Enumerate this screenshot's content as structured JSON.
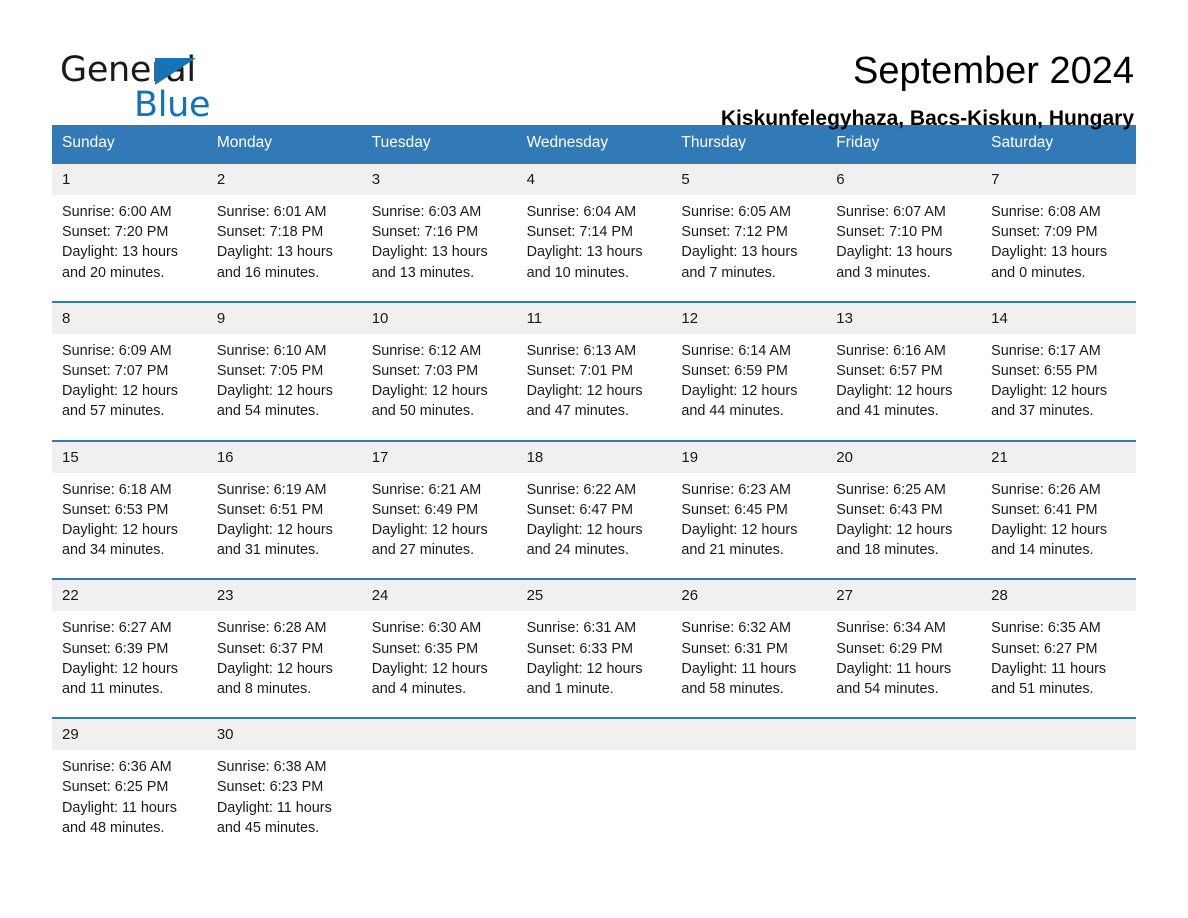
{
  "brand": {
    "word_general": "General",
    "word_blue": "Blue",
    "triangle_color": "#1574b8",
    "blue_text_color": "#0f73bd"
  },
  "header": {
    "month_title": "September 2024",
    "location": "Kiskunfelegyhaza, Bacs-Kiskun, Hungary"
  },
  "theme": {
    "header_blue": "#3279b7",
    "daynum_row_bg": "#f0f0f0",
    "text": "#1a1a1a"
  },
  "calendar": {
    "weekdays": [
      "Sunday",
      "Monday",
      "Tuesday",
      "Wednesday",
      "Thursday",
      "Friday",
      "Saturday"
    ],
    "weeks": [
      {
        "days": [
          {
            "num": "1",
            "sunrise": "Sunrise: 6:00 AM",
            "sunset": "Sunset: 7:20 PM",
            "daylight_1": "Daylight: 13 hours",
            "daylight_2": "and 20 minutes."
          },
          {
            "num": "2",
            "sunrise": "Sunrise: 6:01 AM",
            "sunset": "Sunset: 7:18 PM",
            "daylight_1": "Daylight: 13 hours",
            "daylight_2": "and 16 minutes."
          },
          {
            "num": "3",
            "sunrise": "Sunrise: 6:03 AM",
            "sunset": "Sunset: 7:16 PM",
            "daylight_1": "Daylight: 13 hours",
            "daylight_2": "and 13 minutes."
          },
          {
            "num": "4",
            "sunrise": "Sunrise: 6:04 AM",
            "sunset": "Sunset: 7:14 PM",
            "daylight_1": "Daylight: 13 hours",
            "daylight_2": "and 10 minutes."
          },
          {
            "num": "5",
            "sunrise": "Sunrise: 6:05 AM",
            "sunset": "Sunset: 7:12 PM",
            "daylight_1": "Daylight: 13 hours",
            "daylight_2": "and 7 minutes."
          },
          {
            "num": "6",
            "sunrise": "Sunrise: 6:07 AM",
            "sunset": "Sunset: 7:10 PM",
            "daylight_1": "Daylight: 13 hours",
            "daylight_2": "and 3 minutes."
          },
          {
            "num": "7",
            "sunrise": "Sunrise: 6:08 AM",
            "sunset": "Sunset: 7:09 PM",
            "daylight_1": "Daylight: 13 hours",
            "daylight_2": "and 0 minutes."
          }
        ]
      },
      {
        "days": [
          {
            "num": "8",
            "sunrise": "Sunrise: 6:09 AM",
            "sunset": "Sunset: 7:07 PM",
            "daylight_1": "Daylight: 12 hours",
            "daylight_2": "and 57 minutes."
          },
          {
            "num": "9",
            "sunrise": "Sunrise: 6:10 AM",
            "sunset": "Sunset: 7:05 PM",
            "daylight_1": "Daylight: 12 hours",
            "daylight_2": "and 54 minutes."
          },
          {
            "num": "10",
            "sunrise": "Sunrise: 6:12 AM",
            "sunset": "Sunset: 7:03 PM",
            "daylight_1": "Daylight: 12 hours",
            "daylight_2": "and 50 minutes."
          },
          {
            "num": "11",
            "sunrise": "Sunrise: 6:13 AM",
            "sunset": "Sunset: 7:01 PM",
            "daylight_1": "Daylight: 12 hours",
            "daylight_2": "and 47 minutes."
          },
          {
            "num": "12",
            "sunrise": "Sunrise: 6:14 AM",
            "sunset": "Sunset: 6:59 PM",
            "daylight_1": "Daylight: 12 hours",
            "daylight_2": "and 44 minutes."
          },
          {
            "num": "13",
            "sunrise": "Sunrise: 6:16 AM",
            "sunset": "Sunset: 6:57 PM",
            "daylight_1": "Daylight: 12 hours",
            "daylight_2": "and 41 minutes."
          },
          {
            "num": "14",
            "sunrise": "Sunrise: 6:17 AM",
            "sunset": "Sunset: 6:55 PM",
            "daylight_1": "Daylight: 12 hours",
            "daylight_2": "and 37 minutes."
          }
        ]
      },
      {
        "days": [
          {
            "num": "15",
            "sunrise": "Sunrise: 6:18 AM",
            "sunset": "Sunset: 6:53 PM",
            "daylight_1": "Daylight: 12 hours",
            "daylight_2": "and 34 minutes."
          },
          {
            "num": "16",
            "sunrise": "Sunrise: 6:19 AM",
            "sunset": "Sunset: 6:51 PM",
            "daylight_1": "Daylight: 12 hours",
            "daylight_2": "and 31 minutes."
          },
          {
            "num": "17",
            "sunrise": "Sunrise: 6:21 AM",
            "sunset": "Sunset: 6:49 PM",
            "daylight_1": "Daylight: 12 hours",
            "daylight_2": "and 27 minutes."
          },
          {
            "num": "18",
            "sunrise": "Sunrise: 6:22 AM",
            "sunset": "Sunset: 6:47 PM",
            "daylight_1": "Daylight: 12 hours",
            "daylight_2": "and 24 minutes."
          },
          {
            "num": "19",
            "sunrise": "Sunrise: 6:23 AM",
            "sunset": "Sunset: 6:45 PM",
            "daylight_1": "Daylight: 12 hours",
            "daylight_2": "and 21 minutes."
          },
          {
            "num": "20",
            "sunrise": "Sunrise: 6:25 AM",
            "sunset": "Sunset: 6:43 PM",
            "daylight_1": "Daylight: 12 hours",
            "daylight_2": "and 18 minutes."
          },
          {
            "num": "21",
            "sunrise": "Sunrise: 6:26 AM",
            "sunset": "Sunset: 6:41 PM",
            "daylight_1": "Daylight: 12 hours",
            "daylight_2": "and 14 minutes."
          }
        ]
      },
      {
        "days": [
          {
            "num": "22",
            "sunrise": "Sunrise: 6:27 AM",
            "sunset": "Sunset: 6:39 PM",
            "daylight_1": "Daylight: 12 hours",
            "daylight_2": "and 11 minutes."
          },
          {
            "num": "23",
            "sunrise": "Sunrise: 6:28 AM",
            "sunset": "Sunset: 6:37 PM",
            "daylight_1": "Daylight: 12 hours",
            "daylight_2": "and 8 minutes."
          },
          {
            "num": "24",
            "sunrise": "Sunrise: 6:30 AM",
            "sunset": "Sunset: 6:35 PM",
            "daylight_1": "Daylight: 12 hours",
            "daylight_2": "and 4 minutes."
          },
          {
            "num": "25",
            "sunrise": "Sunrise: 6:31 AM",
            "sunset": "Sunset: 6:33 PM",
            "daylight_1": "Daylight: 12 hours",
            "daylight_2": "and 1 minute."
          },
          {
            "num": "26",
            "sunrise": "Sunrise: 6:32 AM",
            "sunset": "Sunset: 6:31 PM",
            "daylight_1": "Daylight: 11 hours",
            "daylight_2": "and 58 minutes."
          },
          {
            "num": "27",
            "sunrise": "Sunrise: 6:34 AM",
            "sunset": "Sunset: 6:29 PM",
            "daylight_1": "Daylight: 11 hours",
            "daylight_2": "and 54 minutes."
          },
          {
            "num": "28",
            "sunrise": "Sunrise: 6:35 AM",
            "sunset": "Sunset: 6:27 PM",
            "daylight_1": "Daylight: 11 hours",
            "daylight_2": "and 51 minutes."
          }
        ]
      },
      {
        "days": [
          {
            "num": "29",
            "sunrise": "Sunrise: 6:36 AM",
            "sunset": "Sunset: 6:25 PM",
            "daylight_1": "Daylight: 11 hours",
            "daylight_2": "and 48 minutes."
          },
          {
            "num": "30",
            "sunrise": "Sunrise: 6:38 AM",
            "sunset": "Sunset: 6:23 PM",
            "daylight_1": "Daylight: 11 hours",
            "daylight_2": "and 45 minutes."
          },
          {
            "num": "",
            "sunrise": "",
            "sunset": "",
            "daylight_1": "",
            "daylight_2": ""
          },
          {
            "num": "",
            "sunrise": "",
            "sunset": "",
            "daylight_1": "",
            "daylight_2": ""
          },
          {
            "num": "",
            "sunrise": "",
            "sunset": "",
            "daylight_1": "",
            "daylight_2": ""
          },
          {
            "num": "",
            "sunrise": "",
            "sunset": "",
            "daylight_1": "",
            "daylight_2": ""
          },
          {
            "num": "",
            "sunrise": "",
            "sunset": "",
            "daylight_1": "",
            "daylight_2": ""
          }
        ]
      }
    ]
  }
}
